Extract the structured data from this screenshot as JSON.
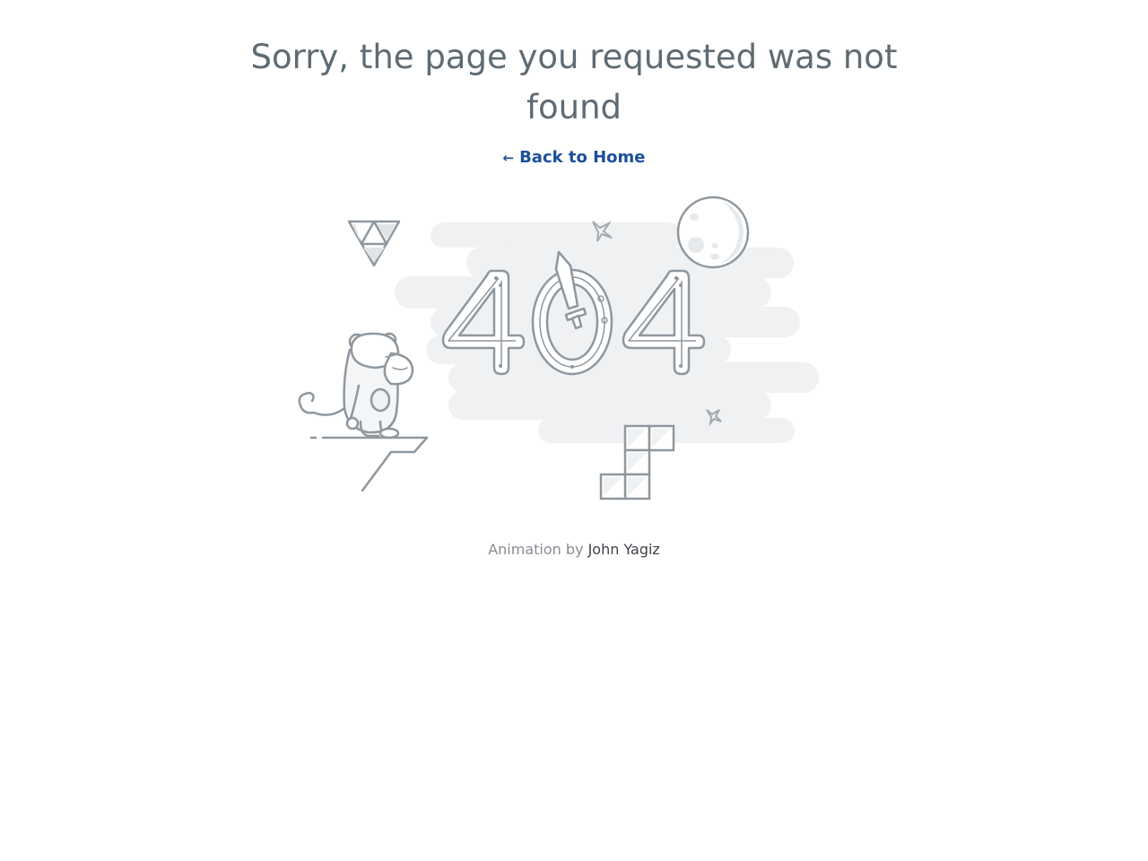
{
  "error": {
    "title": "Sorry, the page you requested was not found",
    "code": "404"
  },
  "navigation": {
    "back_arrow": "←",
    "back_label": "Back to Home"
  },
  "credit": {
    "prefix": "Animation by",
    "author": "John Yagiz"
  },
  "colors": {
    "link": "#1b4f9c",
    "title": "#5f6b73",
    "cloud": "#eff1f3",
    "stroke": "#8f979e"
  },
  "icons": {
    "back": "arrow-left-icon",
    "monkey": "monkey-illustration",
    "moon": "moon-icon",
    "triangle": "triforce-icon",
    "blocks": "tetris-block-icon",
    "sparkle": "sparkle-icon",
    "sword": "sword-icon"
  }
}
